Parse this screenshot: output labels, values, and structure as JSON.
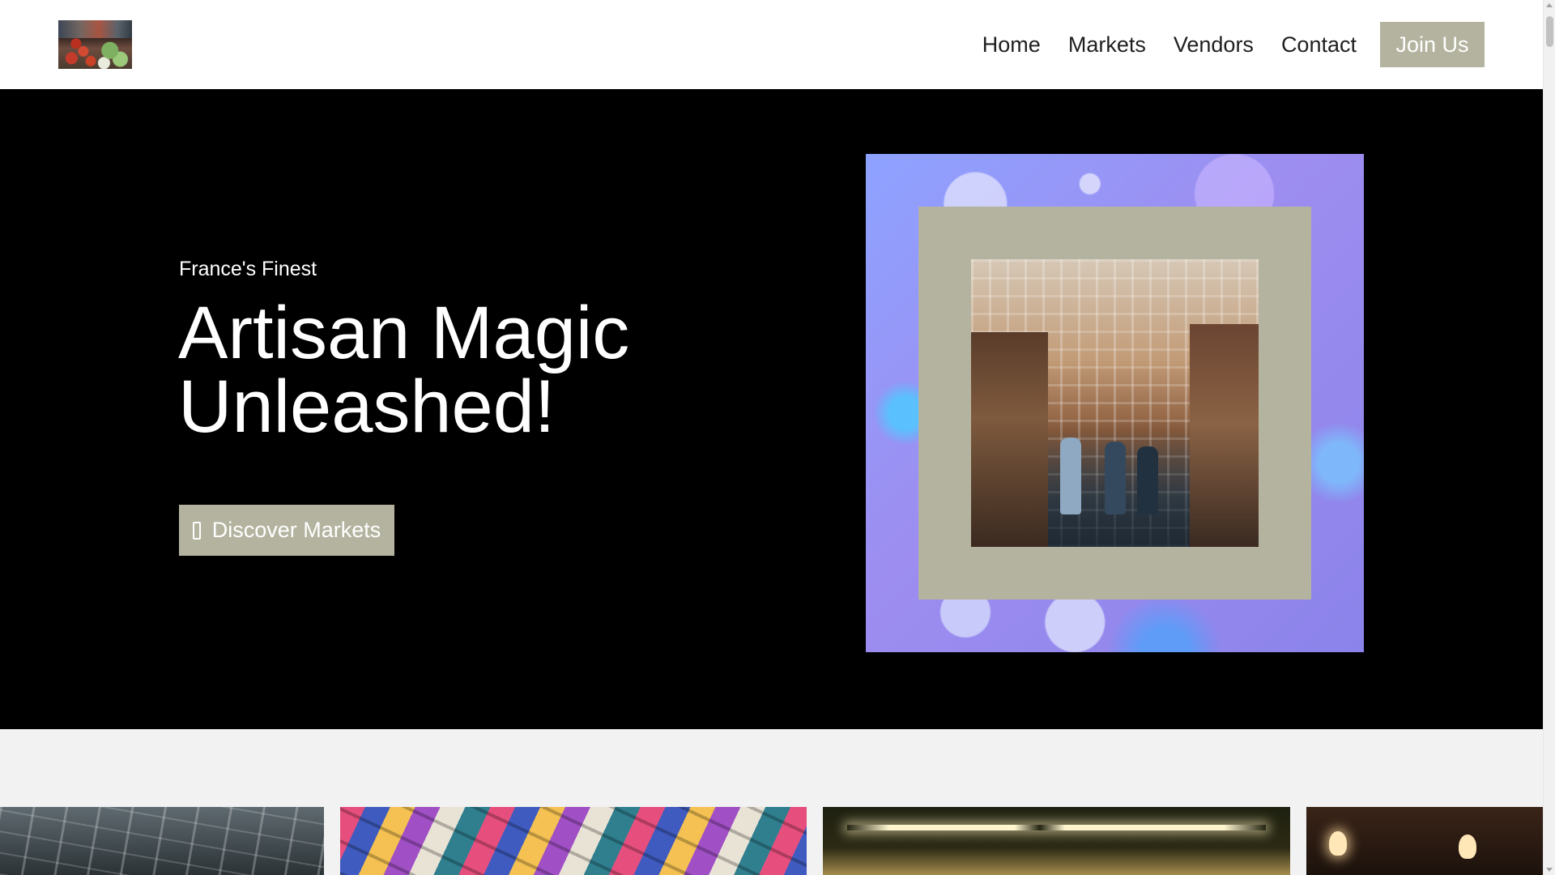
{
  "header": {
    "logo_icon": "market-produce-logo",
    "nav": [
      {
        "label": "Home"
      },
      {
        "label": "Markets"
      },
      {
        "label": "Vendors"
      },
      {
        "label": "Contact"
      }
    ],
    "cta_label": "Join Us"
  },
  "hero": {
    "eyebrow": "France's Finest",
    "headline_line1": "Artisan Magic",
    "headline_line2": "Unleashed!",
    "button_label": "Discover Markets",
    "button_icon": "store-icon"
  },
  "gallery": {
    "tiles": [
      {
        "icon": "market-hall-roof-photo"
      },
      {
        "icon": "colorful-market-tents-photo"
      },
      {
        "icon": "market-ceiling-lights-photo"
      },
      {
        "icon": "hanging-lamps-photo"
      }
    ]
  },
  "colors": {
    "accent": "#b3b39f",
    "hero_background": "#000000",
    "header_background": "#ffffff",
    "page_background": "#f2f2f2",
    "nav_text": "#1f1f1f"
  }
}
